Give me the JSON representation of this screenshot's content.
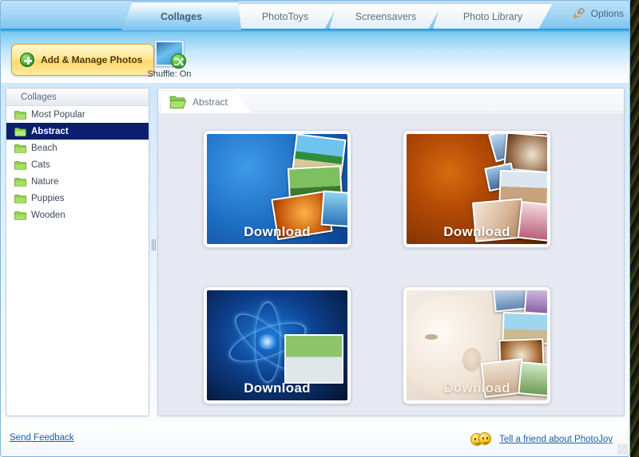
{
  "window": {
    "title": "PhotoJoy"
  },
  "tabs": [
    {
      "label": "Collages",
      "active": true
    },
    {
      "label": "PhotoToys",
      "active": false
    },
    {
      "label": "Screensavers",
      "active": false
    },
    {
      "label": "Photo Library",
      "active": false
    }
  ],
  "options": {
    "label": "Options",
    "icon": "wrench-icon"
  },
  "toolbar": {
    "add_button": {
      "label": "Add & Manage Photos",
      "icon": "plus-circle-icon"
    },
    "shuffle": {
      "label": "Shuffle: On",
      "state": "On",
      "icon": "shuffle-icon"
    }
  },
  "sidebar": {
    "header": "Collages",
    "items": [
      {
        "label": "Most Popular",
        "icon": "folder-icon",
        "selected": false
      },
      {
        "label": "Abstract",
        "icon": "folder-icon",
        "selected": true
      },
      {
        "label": "Beach",
        "icon": "folder-icon",
        "selected": false
      },
      {
        "label": "Cats",
        "icon": "folder-icon",
        "selected": false
      },
      {
        "label": "Nature",
        "icon": "folder-icon",
        "selected": false
      },
      {
        "label": "Puppies",
        "icon": "folder-icon",
        "selected": false
      },
      {
        "label": "Wooden",
        "icon": "folder-icon",
        "selected": false
      }
    ]
  },
  "content": {
    "tab_label": "Abstract",
    "tab_icon": "open-folder-icon",
    "items": [
      {
        "name": "blue-gradient-collage",
        "download_label": "Download",
        "style": "blue",
        "accent": "#1e6fc4"
      },
      {
        "name": "orange-gradient-collage",
        "download_label": "Download",
        "style": "orange",
        "accent": "#b44b05"
      },
      {
        "name": "blue-swirl-collage",
        "download_label": "Download",
        "style": "darkblue",
        "accent": "#0d3f8c"
      },
      {
        "name": "baby-cream-collage",
        "download_label": "Download",
        "style": "cream",
        "accent": "#ddd0c2"
      }
    ]
  },
  "status": {
    "feedback_label": "Send Feedback",
    "tell_friend_label": "Tell a friend about PhotoJoy",
    "tell_friend_icon": "smiley-faces-icon"
  },
  "colors": {
    "tab_active": "#9ad2f4",
    "toolbar_top": "#2f9fe2",
    "selection": "#0b1f6e",
    "content_bg": "#e6e8f2",
    "link": "#1e5fa8",
    "button_gold": "#ffd86b"
  }
}
